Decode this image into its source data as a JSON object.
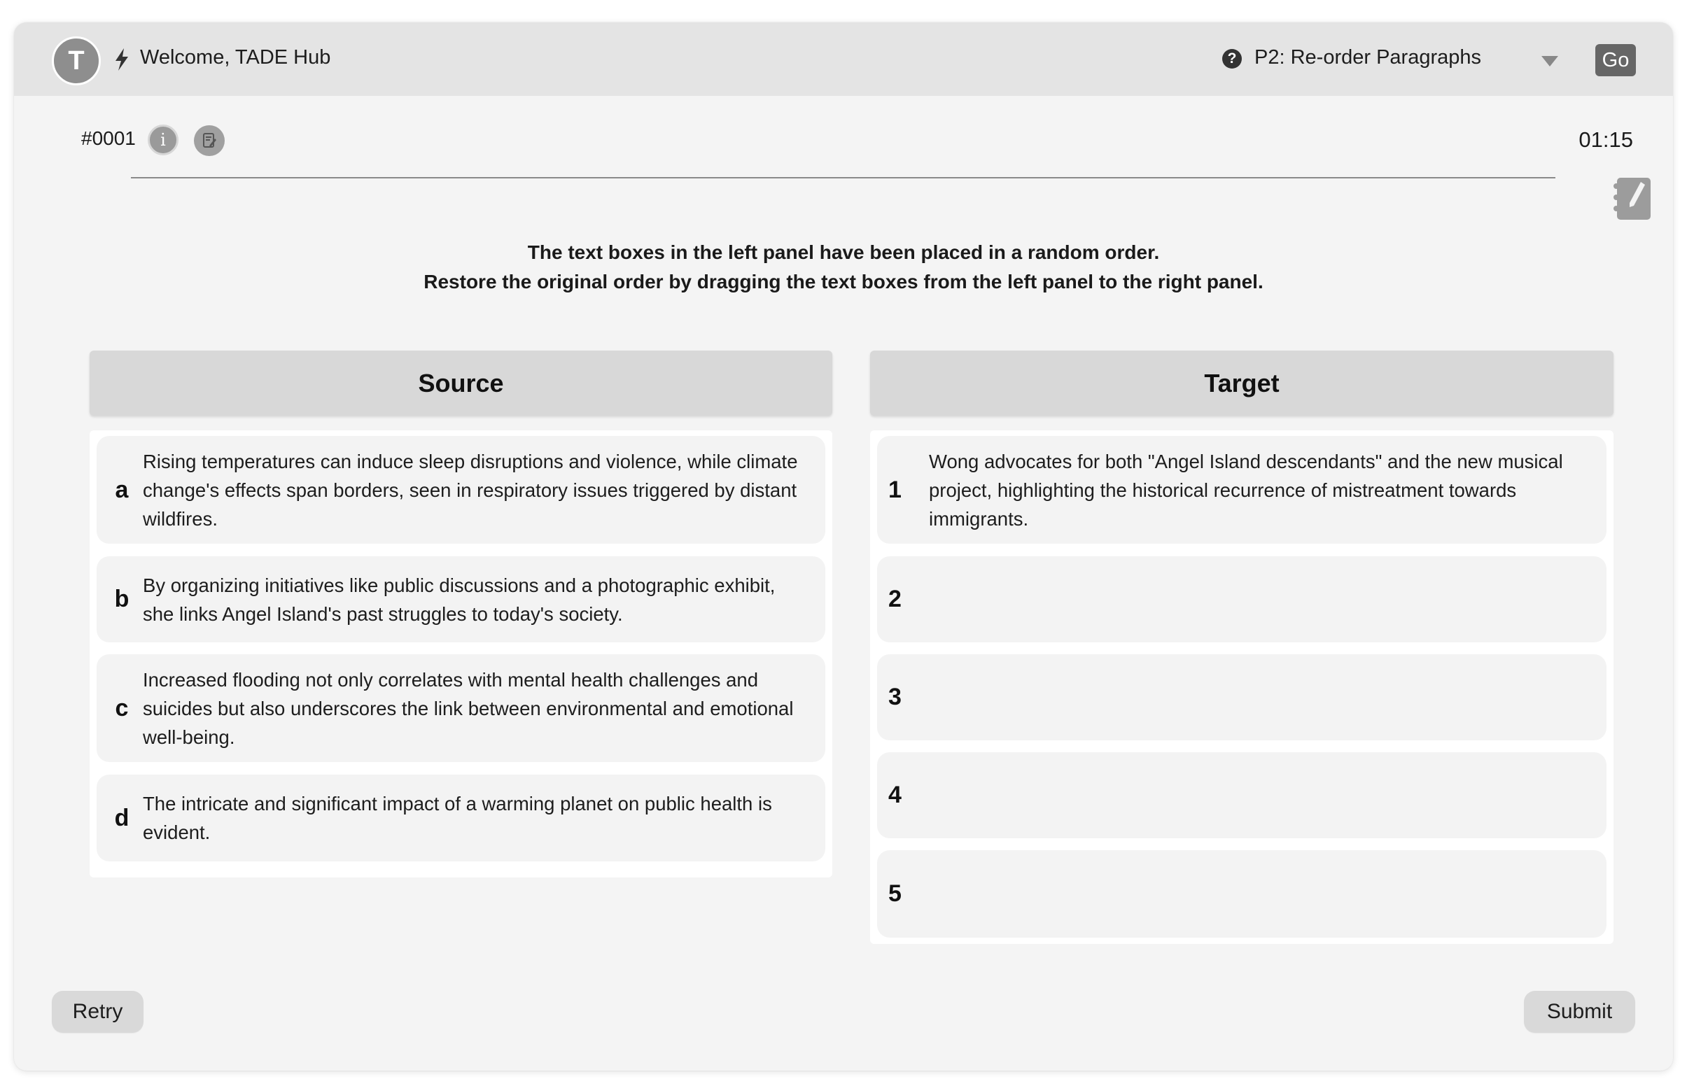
{
  "header": {
    "avatar_initial": "T",
    "welcome": "Welcome, TADE Hub",
    "task_selector": "P2: Re-order Paragraphs",
    "go_label": "Go"
  },
  "question": {
    "id": "#0001",
    "timer": "01:15"
  },
  "instructions": [
    "The text boxes in the left panel have been placed in a random order.",
    "Restore the original order by dragging the text boxes from the left panel to the right panel."
  ],
  "source": {
    "title": "Source",
    "items": [
      {
        "key": "a",
        "text": "Rising temperatures can induce sleep disruptions and violence, while climate change's effects span borders, seen in respiratory issues triggered by distant wildfires."
      },
      {
        "key": "b",
        "text": "By organizing initiatives like public discussions and a photographic exhibit, she links Angel Island's past struggles to today's society."
      },
      {
        "key": "c",
        "text": "Increased flooding not only correlates with mental health challenges and suicides but also underscores the link between environmental and emotional well-being."
      },
      {
        "key": "d",
        "text": "The intricate and significant impact of a warming planet on public health is evident."
      }
    ]
  },
  "target": {
    "title": "Target",
    "items": [
      {
        "key": "1",
        "text": "Wong advocates for both \"Angel Island descendants\" and the new musical project, highlighting the historical recurrence of mistreatment towards immigrants."
      },
      {
        "key": "2",
        "text": ""
      },
      {
        "key": "3",
        "text": ""
      },
      {
        "key": "4",
        "text": ""
      },
      {
        "key": "5",
        "text": ""
      }
    ]
  },
  "footer": {
    "retry_label": "Retry",
    "submit_label": "Submit"
  },
  "icons": {
    "help": "?",
    "info": "i"
  }
}
